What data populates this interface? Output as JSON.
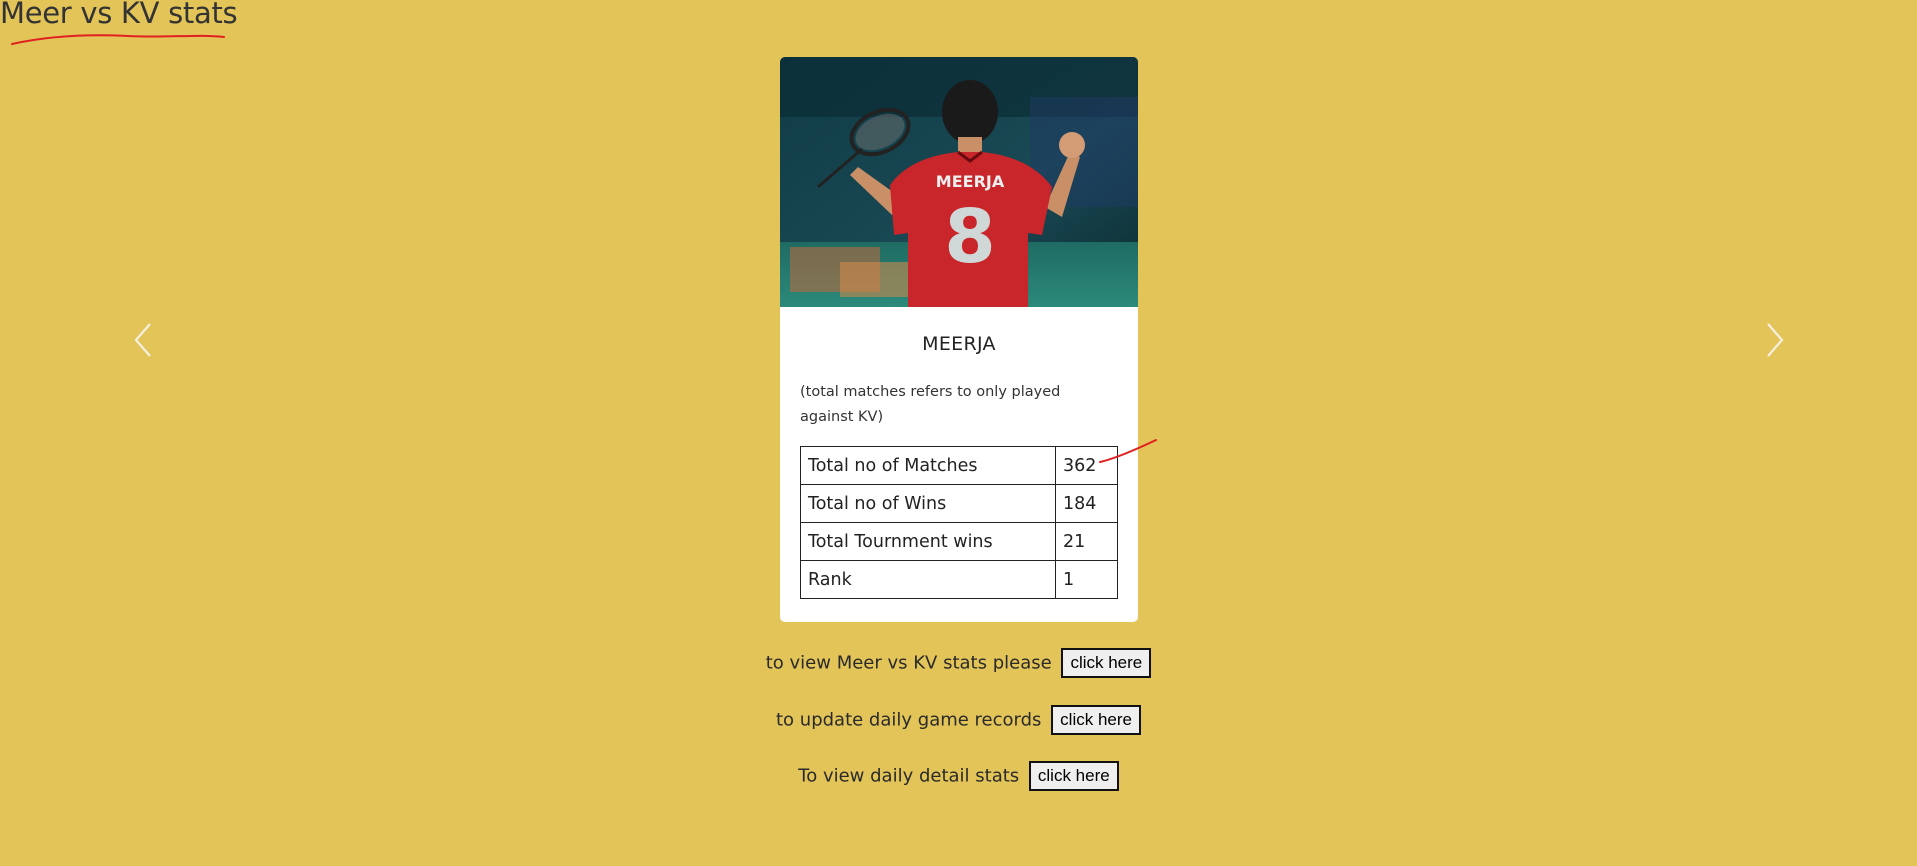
{
  "page": {
    "title": "Meer vs KV stats"
  },
  "carousel": {
    "prev_icon": "chevron-left-icon",
    "next_icon": "chevron-right-icon"
  },
  "card": {
    "player_name": "MEERJA",
    "jersey_name": "MEERJA",
    "jersey_number": "8",
    "note": "(total matches refers to only played against KV)",
    "stats": [
      {
        "label": "Total no of Matches",
        "value": "362"
      },
      {
        "label": "Total no of Wins",
        "value": "184"
      },
      {
        "label": "Total Tournment wins",
        "value": "21"
      },
      {
        "label": "Rank",
        "value": "1"
      }
    ]
  },
  "actions": [
    {
      "text": "to view Meer vs KV stats please",
      "button": "click here"
    },
    {
      "text": "to update daily game records",
      "button": "click here"
    },
    {
      "text": "To view daily detail stats",
      "button": "click here"
    }
  ],
  "colors": {
    "background": "#e2c458",
    "annotation": "#e02020",
    "jersey": "#c8262a"
  }
}
